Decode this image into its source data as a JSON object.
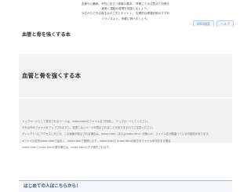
{
  "notice": {
    "lines": [
      "血管や心臓病、予防に役立つ食事の基本。 季節ごとの注意点と対策を",
      "食事と運動の習慣を見直しましょう。",
      "今日からできる食生活の工夫とポイント。 定期的な健康診断のすすめ",
      "バランスよく、気軽に続けましょう。"
    ]
  },
  "nav": {
    "items": [
      "WEB検索",
      "ヘルプ"
    ]
  },
  "page": {
    "title": "血管と骨を強くする本"
  },
  "info": {
    "paragraphs": [
      "トップページとして表示されるページは、index.htmlのファイル名で作成し、アップロードしてください。",
      "それ以外のファイルをアップされますと、意図しないページが表示されることがありますのでご注意ください。",
      "ディレクトリにアクセスしたとき、この画面が表示される場合は、index.html（またはindex.htm）が無いか、ファイル名が間違っている可能性があります。",
      "※ファイル名をindex.htmlではなく、index.htmで登録したり、index.htmlと index.htmの両方のファイルが存在する場合、",
      "index.htmlとindex.htmの優先順位は、index.htmlの方が優先されます。"
    ]
  },
  "guide": {
    "label": "はじめての人はこちらから！"
  }
}
